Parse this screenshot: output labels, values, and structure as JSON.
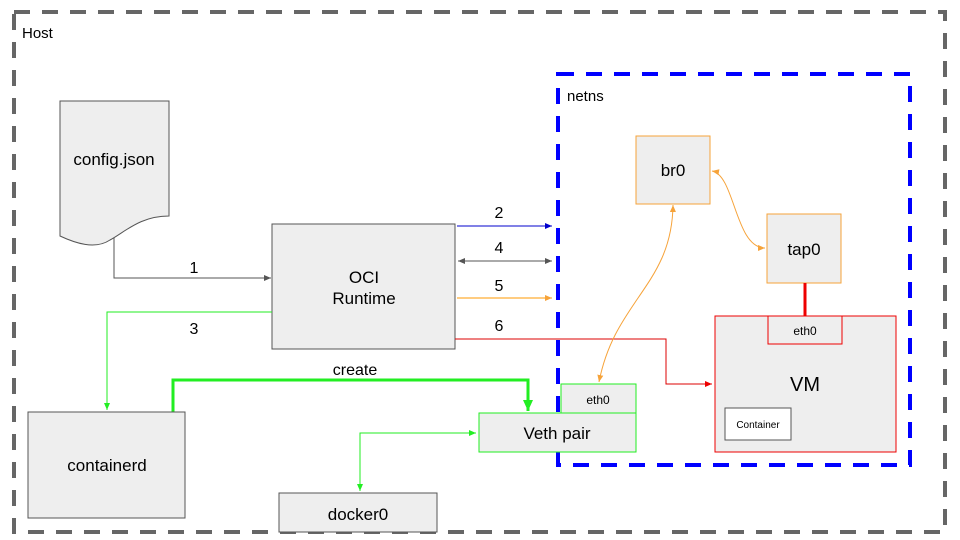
{
  "regions": {
    "host": {
      "label": "Host",
      "border_color": "#666666"
    },
    "netns": {
      "label": "netns",
      "border_color": "#0000ff"
    }
  },
  "nodes": {
    "config": {
      "label": "config.json"
    },
    "runtime": {
      "line1": "OCI",
      "line2": "Runtime"
    },
    "containerd": {
      "label": "containerd"
    },
    "docker0": {
      "label": "docker0"
    },
    "veth": {
      "label": "Veth pair",
      "eth_label": "eth0"
    },
    "br0": {
      "label": "br0"
    },
    "tap0": {
      "label": "tap0"
    },
    "vm": {
      "label": "VM",
      "eth_label": "eth0",
      "container_label": "Container"
    }
  },
  "edges": {
    "e1": {
      "label": "1",
      "color": "#555555"
    },
    "e2": {
      "label": "2",
      "color": "#0000cc"
    },
    "e3": {
      "label": "3",
      "color": "#00ee00"
    },
    "e4": {
      "label": "4",
      "color": "#555555"
    },
    "e5": {
      "label": "5",
      "color": "#ff9900"
    },
    "e6": {
      "label": "6",
      "color": "#dd0000"
    },
    "create": {
      "label": "create",
      "color": "#00ee00"
    }
  },
  "colors": {
    "node_fill": "#eeeeee",
    "node_stroke": "#555555",
    "orange": "#f6a33a",
    "green": "#22ee22",
    "red": "#ee0000"
  }
}
